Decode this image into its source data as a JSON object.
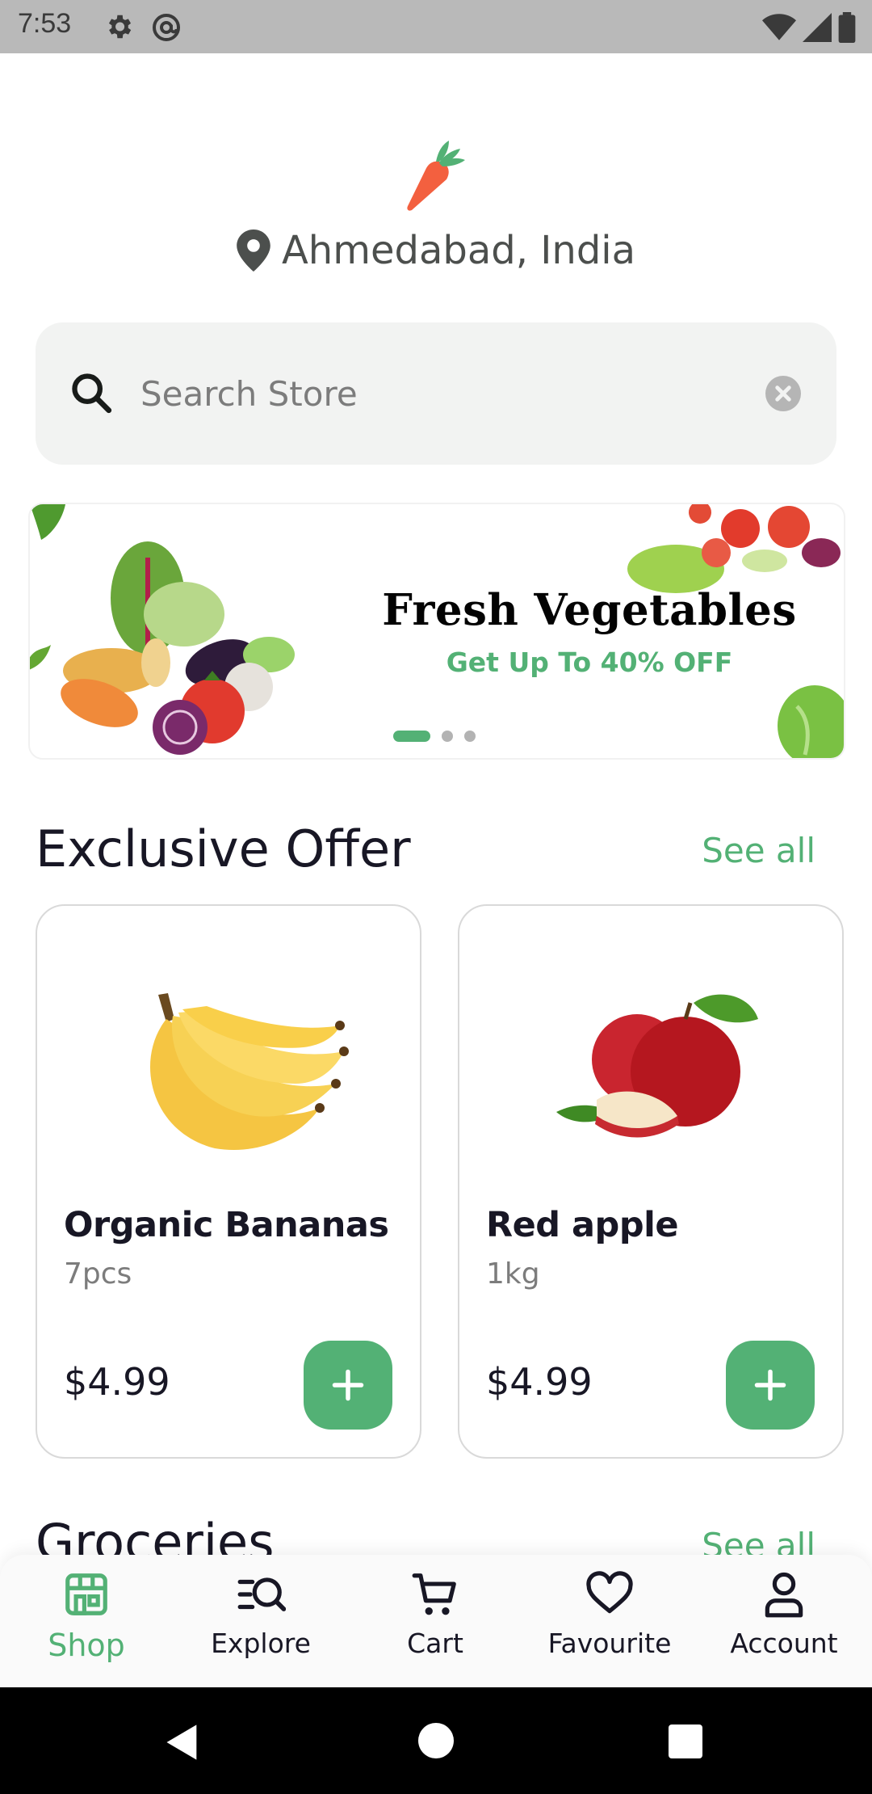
{
  "status_bar": {
    "time": "7:53"
  },
  "header": {
    "location": "Ahmedabad, India"
  },
  "search": {
    "placeholder": "Search Store",
    "value": ""
  },
  "banner": {
    "title": "Fresh Vegetables",
    "subtitle": "Get Up To 40% OFF",
    "pages": 3,
    "active_page": 1
  },
  "sections": [
    {
      "title": "Exclusive Offer",
      "see_all": "See all"
    },
    {
      "title": "Groceries",
      "see_all": "See all"
    }
  ],
  "products": [
    {
      "name": "Organic Bananas",
      "unit": "7pcs",
      "price": "$4.99",
      "image": "bananas"
    },
    {
      "name": "Red apple",
      "unit": "1kg",
      "price": "$4.99",
      "image": "red-apple"
    }
  ],
  "bottom_nav": {
    "active": "Shop",
    "items": [
      {
        "label": "Shop",
        "icon": "store-icon"
      },
      {
        "label": "Explore",
        "icon": "explore-icon"
      },
      {
        "label": "Cart",
        "icon": "cart-icon"
      },
      {
        "label": "Favourite",
        "icon": "heart-icon"
      },
      {
        "label": "Account",
        "icon": "account-icon"
      }
    ]
  },
  "colors": {
    "accent": "#53B175",
    "text": "#181725",
    "muted": "#7C7C7C",
    "search_bg": "#F2F3F2",
    "status_bar": "#B9B9B9"
  }
}
